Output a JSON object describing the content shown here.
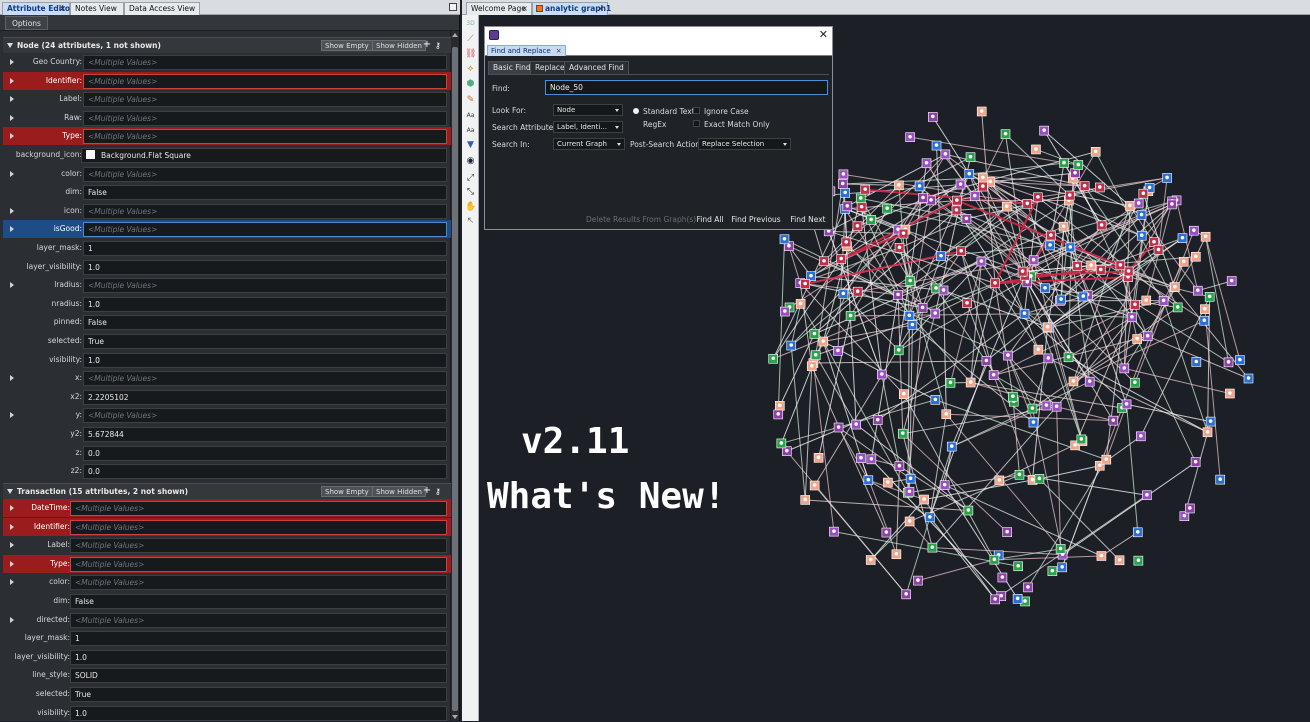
{
  "left_tabs": [
    {
      "label": "Attribute Editor",
      "active": true
    },
    {
      "label": "Notes View",
      "active": false
    },
    {
      "label": "Data Access View",
      "active": false
    }
  ],
  "options_label": "Options",
  "node_section": {
    "title": "Node  (24 attributes, 1 not shown)",
    "show_empty": "Show Empty",
    "show_hidden": "Show Hidden",
    "rows": [
      {
        "label": "Geo Country:",
        "value": "<Multiple Values>",
        "multi": true,
        "expand": true,
        "state": ""
      },
      {
        "label": "Identifier:",
        "value": "<Multiple Values>",
        "multi": true,
        "expand": true,
        "state": "red"
      },
      {
        "label": "Label:",
        "value": "<Multiple Values>",
        "multi": true,
        "expand": true,
        "state": ""
      },
      {
        "label": "Raw:",
        "value": "<Multiple Values>",
        "multi": true,
        "expand": true,
        "state": ""
      },
      {
        "label": "Type:",
        "value": "<Multiple Values>",
        "multi": true,
        "expand": true,
        "state": "red"
      },
      {
        "label": "background_icon:",
        "value": "Background.Flat Square",
        "multi": false,
        "expand": false,
        "state": "",
        "swatch": true
      },
      {
        "label": "color:",
        "value": "<Multiple Values>",
        "multi": true,
        "expand": true,
        "state": ""
      },
      {
        "label": "dim:",
        "value": "False",
        "multi": false,
        "expand": false,
        "state": ""
      },
      {
        "label": "icon:",
        "value": "<Multiple Values>",
        "multi": true,
        "expand": true,
        "state": ""
      },
      {
        "label": "isGood:",
        "value": "<Multiple Values>",
        "multi": true,
        "expand": true,
        "state": "blue"
      },
      {
        "label": "layer_mask:",
        "value": "1",
        "multi": false,
        "expand": false,
        "state": ""
      },
      {
        "label": "layer_visibility:",
        "value": "1.0",
        "multi": false,
        "expand": false,
        "state": ""
      },
      {
        "label": "lradius:",
        "value": "<Multiple Values>",
        "multi": true,
        "expand": true,
        "state": ""
      },
      {
        "label": "nradius:",
        "value": "1.0",
        "multi": false,
        "expand": false,
        "state": ""
      },
      {
        "label": "pinned:",
        "value": "False",
        "multi": false,
        "expand": false,
        "state": ""
      },
      {
        "label": "selected:",
        "value": "True",
        "multi": false,
        "expand": false,
        "state": ""
      },
      {
        "label": "visibility:",
        "value": "1.0",
        "multi": false,
        "expand": false,
        "state": ""
      },
      {
        "label": "x:",
        "value": "<Multiple Values>",
        "multi": true,
        "expand": true,
        "state": ""
      },
      {
        "label": "x2:",
        "value": "2.2205102",
        "multi": false,
        "expand": false,
        "state": ""
      },
      {
        "label": "y:",
        "value": "<Multiple Values>",
        "multi": true,
        "expand": true,
        "state": ""
      },
      {
        "label": "y2:",
        "value": "5.672844",
        "multi": false,
        "expand": false,
        "state": ""
      },
      {
        "label": "z:",
        "value": "0.0",
        "multi": false,
        "expand": false,
        "state": ""
      },
      {
        "label": "z2:",
        "value": "0.0",
        "multi": false,
        "expand": false,
        "state": ""
      }
    ]
  },
  "transaction_section": {
    "title": "Transaction  (15 attributes, 2 not shown)",
    "show_empty": "Show Empty",
    "show_hidden": "Show Hidden",
    "rows": [
      {
        "label": "DateTime:",
        "value": "<Multiple Values>",
        "multi": true,
        "expand": true,
        "state": "red"
      },
      {
        "label": "Identifier:",
        "value": "<Multiple Values>",
        "multi": true,
        "expand": true,
        "state": "red"
      },
      {
        "label": "Label:",
        "value": "<Multiple Values>",
        "multi": true,
        "expand": true,
        "state": ""
      },
      {
        "label": "Type:",
        "value": "<Multiple Values>",
        "multi": true,
        "expand": true,
        "state": "red"
      },
      {
        "label": "color:",
        "value": "<Multiple Values>",
        "multi": true,
        "expand": true,
        "state": ""
      },
      {
        "label": "dim:",
        "value": "False",
        "multi": false,
        "expand": false,
        "state": ""
      },
      {
        "label": "directed:",
        "value": "<Multiple Values>",
        "multi": true,
        "expand": true,
        "state": ""
      },
      {
        "label": "layer_mask:",
        "value": "1",
        "multi": false,
        "expand": false,
        "state": ""
      },
      {
        "label": "layer_visibility:",
        "value": "1.0",
        "multi": false,
        "expand": false,
        "state": ""
      },
      {
        "label": "line_style:",
        "value": "SOLID",
        "multi": false,
        "expand": false,
        "state": ""
      },
      {
        "label": "selected:",
        "value": "True",
        "multi": false,
        "expand": false,
        "state": ""
      },
      {
        "label": "visibility:",
        "value": "1.0",
        "multi": false,
        "expand": false,
        "state": ""
      }
    ]
  },
  "right_tabs": [
    {
      "label": "Welcome Page",
      "active": false
    },
    {
      "label": "analytic graph1",
      "active": true
    }
  ],
  "toolbar_icons": [
    "3d-icon",
    "draw-edge-icon",
    "link-icon",
    "merge-icon",
    "color-nodes-icon",
    "pin-icon",
    "label-icon",
    "label-alt-icon",
    "filter-icon",
    "eye-icon",
    "expand-icon",
    "collapse-icon",
    "hand-icon",
    "pointer-icon"
  ],
  "overlay": {
    "version": "v2.11",
    "headline": "What's New!"
  },
  "dialog": {
    "tab_label": "Find and Replace",
    "subtabs": [
      "Basic Find",
      "Replace",
      "Advanced Find"
    ],
    "find_label": "Find:",
    "find_value": "Node_50",
    "look_for_label": "Look For:",
    "look_for_value": "Node",
    "search_attrs_label": "Search Attributes:",
    "search_attrs_value": "Label, Identi...",
    "search_in_label": "Search In:",
    "search_in_value": "Current Graph",
    "post_search_label": "Post-Search Action:",
    "post_search_value": "Replace Selection",
    "standard_text": "Standard Text",
    "regex": "RegEx",
    "ignore_case": "Ignore Case",
    "exact_match": "Exact Match Only",
    "buttons": {
      "delete": "Delete Results From Graph(s)",
      "find_all": "Find All",
      "find_prev": "Find Previous",
      "find_next": "Find Next"
    }
  },
  "colors": {
    "accent_red": "#9b1c1c",
    "accent_blue": "#1f4b86",
    "canvas_bg": "#1c2026"
  }
}
